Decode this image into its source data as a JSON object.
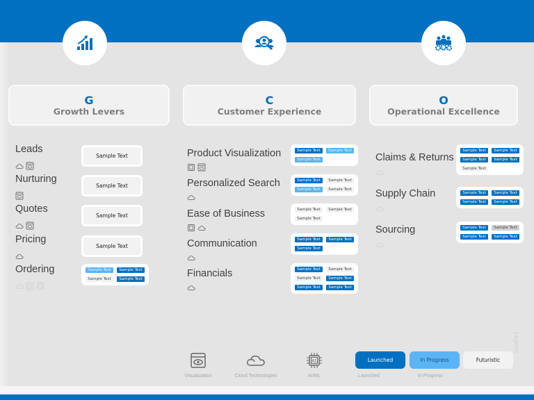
{
  "pillars": [
    {
      "icon": "growth-chart-icon",
      "letter": "G",
      "title": "Growth Levers",
      "items": [
        {
          "label": "Leads",
          "icons": [
            "cloud-icon",
            "visualization-icon"
          ],
          "cell": {
            "type": "single",
            "text": "Sample Text",
            "status": "futuristic"
          }
        },
        {
          "label": "Nurturing",
          "icons": [
            "visualization-icon"
          ],
          "cell": {
            "type": "single",
            "text": "Sample Text",
            "status": "futuristic"
          }
        },
        {
          "label": "Quotes",
          "icons": [
            "cloud-icon",
            "visualization-icon"
          ],
          "cell": {
            "type": "single",
            "text": "Sample Text",
            "status": "futuristic"
          }
        },
        {
          "label": "Pricing",
          "icons": [
            "cloud-icon"
          ],
          "cell": {
            "type": "single",
            "text": "Sample Text",
            "status": "futuristic"
          }
        },
        {
          "label": "Ordering",
          "icons": [
            "cloud-icon",
            "visualization-icon",
            "ai-ml-icon"
          ],
          "icons_faded": true,
          "cell": {
            "type": "tags",
            "tags": [
              {
                "text": "Sample Text",
                "status": "in-progress"
              },
              {
                "text": "Sample Text",
                "status": "launched"
              },
              {
                "text": "Sample Text",
                "status": "futuristic"
              },
              {
                "text": "Sample Text",
                "status": "launched"
              }
            ]
          }
        }
      ]
    },
    {
      "icon": "customer-search-icon",
      "letter": "C",
      "title": "Customer Experience",
      "items": [
        {
          "label": "Product Visualization",
          "icons": [
            "ai-ml-icon",
            "visualization-icon"
          ],
          "cell": {
            "type": "tags",
            "tags": [
              {
                "text": "Sample Text",
                "status": "launched"
              },
              {
                "text": "Sample Text",
                "status": "in-progress"
              },
              {
                "text": "Sample Text",
                "status": "in-progress"
              }
            ]
          }
        },
        {
          "label": "Personalized Search",
          "icons": [
            "cloud-icon"
          ],
          "cell": {
            "type": "tags",
            "tags": [
              {
                "text": "Sample Text",
                "status": "launched"
              },
              {
                "text": "Sample Text",
                "status": "futuristic"
              },
              {
                "text": "Sample Text",
                "status": "in-progress"
              },
              {
                "text": "Sample Text",
                "status": "futuristic"
              }
            ]
          }
        },
        {
          "label": "Ease of Business",
          "icons": [
            "ai-ml-icon",
            "cloud-icon"
          ],
          "cell": {
            "type": "tags",
            "tags": [
              {
                "text": "Sample Text",
                "status": "futuristic"
              },
              {
                "text": "Sample Text",
                "status": "futuristic"
              },
              {
                "text": "Sample Text",
                "status": "futuristic"
              }
            ]
          }
        },
        {
          "label": "Communication",
          "icons": [
            "cloud-icon"
          ],
          "cell": {
            "type": "tags",
            "tags": [
              {
                "text": "Sample Text",
                "status": "launched"
              },
              {
                "text": "Sample Text",
                "status": "launched"
              },
              {
                "text": "Sample Text",
                "status": "launched"
              }
            ]
          }
        },
        {
          "label": "Financials",
          "icons": [
            "cloud-icon"
          ],
          "cell": {
            "type": "tags",
            "tags": [
              {
                "text": "Sample Text",
                "status": "launched"
              },
              {
                "text": "Sample Text",
                "status": "futuristic"
              },
              {
                "text": "Sample Text",
                "status": "futuristic"
              },
              {
                "text": "Sample Text",
                "status": "launched"
              },
              {
                "text": "Sample Text",
                "status": "launched"
              },
              {
                "text": "Sample Text",
                "status": "launched"
              }
            ]
          }
        }
      ]
    },
    {
      "icon": "team-gears-icon",
      "letter": "O",
      "title": "Operational Excellence",
      "items": [
        {
          "label": "Claims & Returns",
          "icons": [
            "cloud-icon"
          ],
          "icons_faded": true,
          "cell": {
            "type": "tags",
            "tags": [
              {
                "text": "Sample Text",
                "status": "launched"
              },
              {
                "text": "Sample Text",
                "status": "launched"
              },
              {
                "text": "Sample Text",
                "status": "launched"
              },
              {
                "text": "Sample Text",
                "status": "launched"
              },
              {
                "text": "Sample Text",
                "status": "futuristic"
              }
            ]
          }
        },
        {
          "label": "Supply Chain",
          "icons": [
            "cloud-icon"
          ],
          "icons_faded": true,
          "cell": {
            "type": "tags",
            "tags": [
              {
                "text": "Sample Text",
                "status": "launched"
              },
              {
                "text": "Sample Text",
                "status": "launched"
              },
              {
                "text": "Sample Text",
                "status": "launched"
              },
              {
                "text": "Sample Text",
                "status": "launched"
              }
            ]
          }
        },
        {
          "label": "Sourcing",
          "icons": [
            "cloud-icon"
          ],
          "icons_faded": true,
          "cell": {
            "type": "tags",
            "tags": [
              {
                "text": "Sample Text",
                "status": "launched"
              },
              {
                "text": "Sample Text",
                "status": "gray"
              },
              {
                "text": "Sample Text",
                "status": "launched"
              },
              {
                "text": "Sample Text",
                "status": "launched"
              }
            ]
          }
        }
      ]
    }
  ],
  "legend": {
    "title": "Legend",
    "icons": [
      {
        "icon": "visualization-icon",
        "label": "Visualization"
      },
      {
        "icon": "cloud-icon",
        "label": "Cloud Technologies"
      },
      {
        "icon": "ai-ml-icon",
        "label": "AI/ML"
      }
    ],
    "statuses": [
      {
        "label": "Launched",
        "caption": "Launched",
        "status": "launched"
      },
      {
        "label": "In Progress",
        "caption": "In Progress",
        "status": "in-progress"
      },
      {
        "label": "Futuristic",
        "caption": "",
        "status": "futuristic"
      }
    ]
  },
  "colors": {
    "brand": "#0070c0",
    "launched": "#0070c0",
    "in_progress": "#5bb4f3",
    "futuristic": "#f2f2f2",
    "background": "#e4e4e4"
  }
}
